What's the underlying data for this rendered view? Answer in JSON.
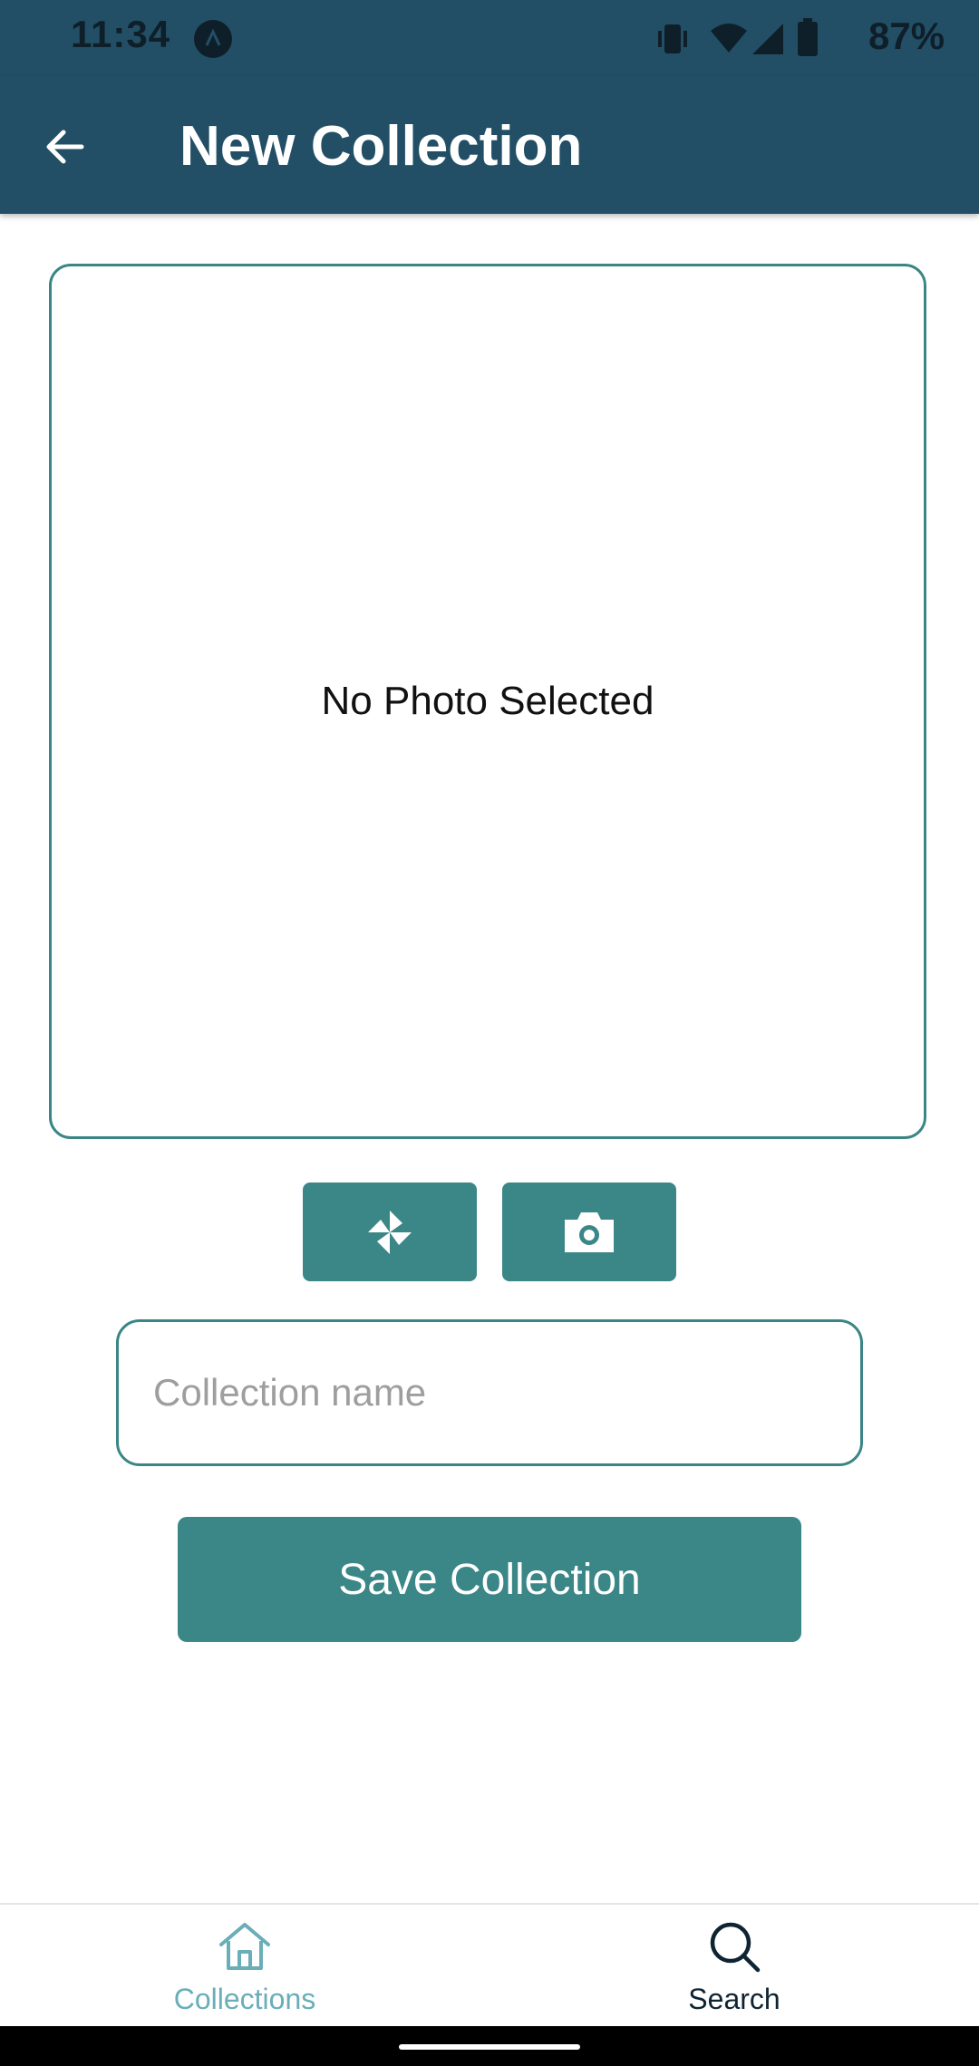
{
  "status_bar": {
    "time": "11:34",
    "battery": "87%"
  },
  "app_bar": {
    "title": "New Collection",
    "back_icon": "arrow-back-icon"
  },
  "photo": {
    "placeholder_text": "No Photo Selected"
  },
  "photo_actions": [
    {
      "icon": "pinwheel-gallery-icon"
    },
    {
      "icon": "camera-icon"
    }
  ],
  "form": {
    "name_value": "",
    "name_placeholder": "Collection name",
    "save_label": "Save Collection"
  },
  "bottom_nav": {
    "items": [
      {
        "label": "Collections",
        "icon": "home-icon",
        "active": true
      },
      {
        "label": "Search",
        "icon": "search-icon",
        "active": false
      }
    ]
  },
  "colors": {
    "appbar": "#224f66",
    "accent": "#3b8686",
    "nav_active": "#6aaeb8",
    "nav_inactive": "#0f2433"
  }
}
